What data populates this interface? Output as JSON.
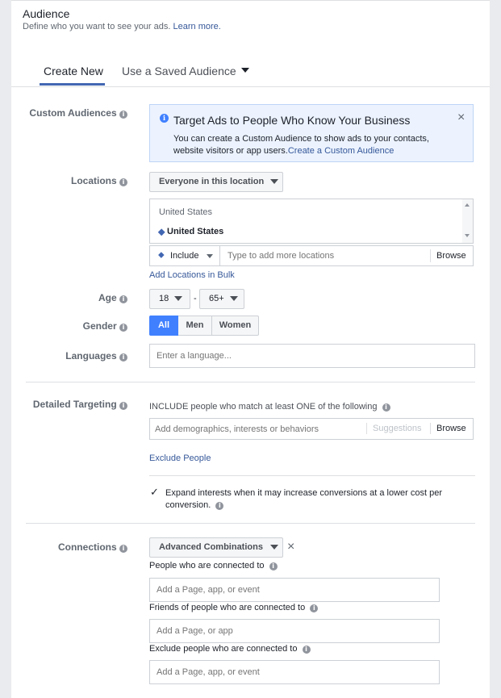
{
  "header": {
    "title": "Audience",
    "subtitle": "Define who you want to see your ads.",
    "learn_more": "Learn more."
  },
  "tabs": [
    {
      "label": "Create New",
      "active": true
    },
    {
      "label": "Use a Saved Audience",
      "active": false
    }
  ],
  "custom_audiences": {
    "label": "Custom Audiences",
    "notice_title": "Target Ads to People Who Know Your Business",
    "notice_body": "You can create a Custom Audience to show ads to your contacts, website visitors or app users.",
    "notice_link": "Create a Custom Audience",
    "close_symbol": "×"
  },
  "locations": {
    "label": "Locations",
    "dropdown_value": "Everyone in this location",
    "group_header": "United States",
    "selected_location": "United States",
    "include_value": "Include",
    "search_placeholder": "Type to add more locations",
    "browse_label": "Browse",
    "bulk_link": "Add Locations in Bulk"
  },
  "age": {
    "label": "Age",
    "min": "18",
    "separator": "-",
    "max": "65+"
  },
  "gender": {
    "label": "Gender",
    "options": [
      "All",
      "Men",
      "Women"
    ],
    "selected": "All"
  },
  "languages": {
    "label": "Languages",
    "placeholder": "Enter a language..."
  },
  "detailed_targeting": {
    "label": "Detailed Targeting",
    "include_text": "INCLUDE people who match at least ONE of the following",
    "search_placeholder": "Add demographics, interests or behaviors",
    "suggestions_label": "Suggestions",
    "browse_label": "Browse",
    "exclude_link": "Exclude People",
    "expand_text": "Expand interests when it may increase conversions at a lower cost per conversion.",
    "expand_checked": true
  },
  "connections": {
    "label": "Connections",
    "dropdown_value": "Advanced Combinations",
    "close_symbol": "×",
    "connected_label": "People who are connected to",
    "connected_placeholder": "Add a Page, app, or event",
    "friends_label": "Friends of people who are connected to",
    "friends_placeholder": "Add a Page, or app",
    "exclude_label": "Exclude people who are connected to",
    "exclude_placeholder": "Add a Page, app, or event"
  },
  "colors": {
    "accent": "#4267b2",
    "link": "#365899",
    "notice_bg": "#ecf3ff",
    "selected_segment": "#4080ff"
  },
  "icons": [
    "info-icon",
    "close-icon",
    "caret-down-icon",
    "location-pin-icon",
    "checkmark-icon",
    "scroll-up-arrow-icon",
    "scroll-down-arrow-icon"
  ]
}
